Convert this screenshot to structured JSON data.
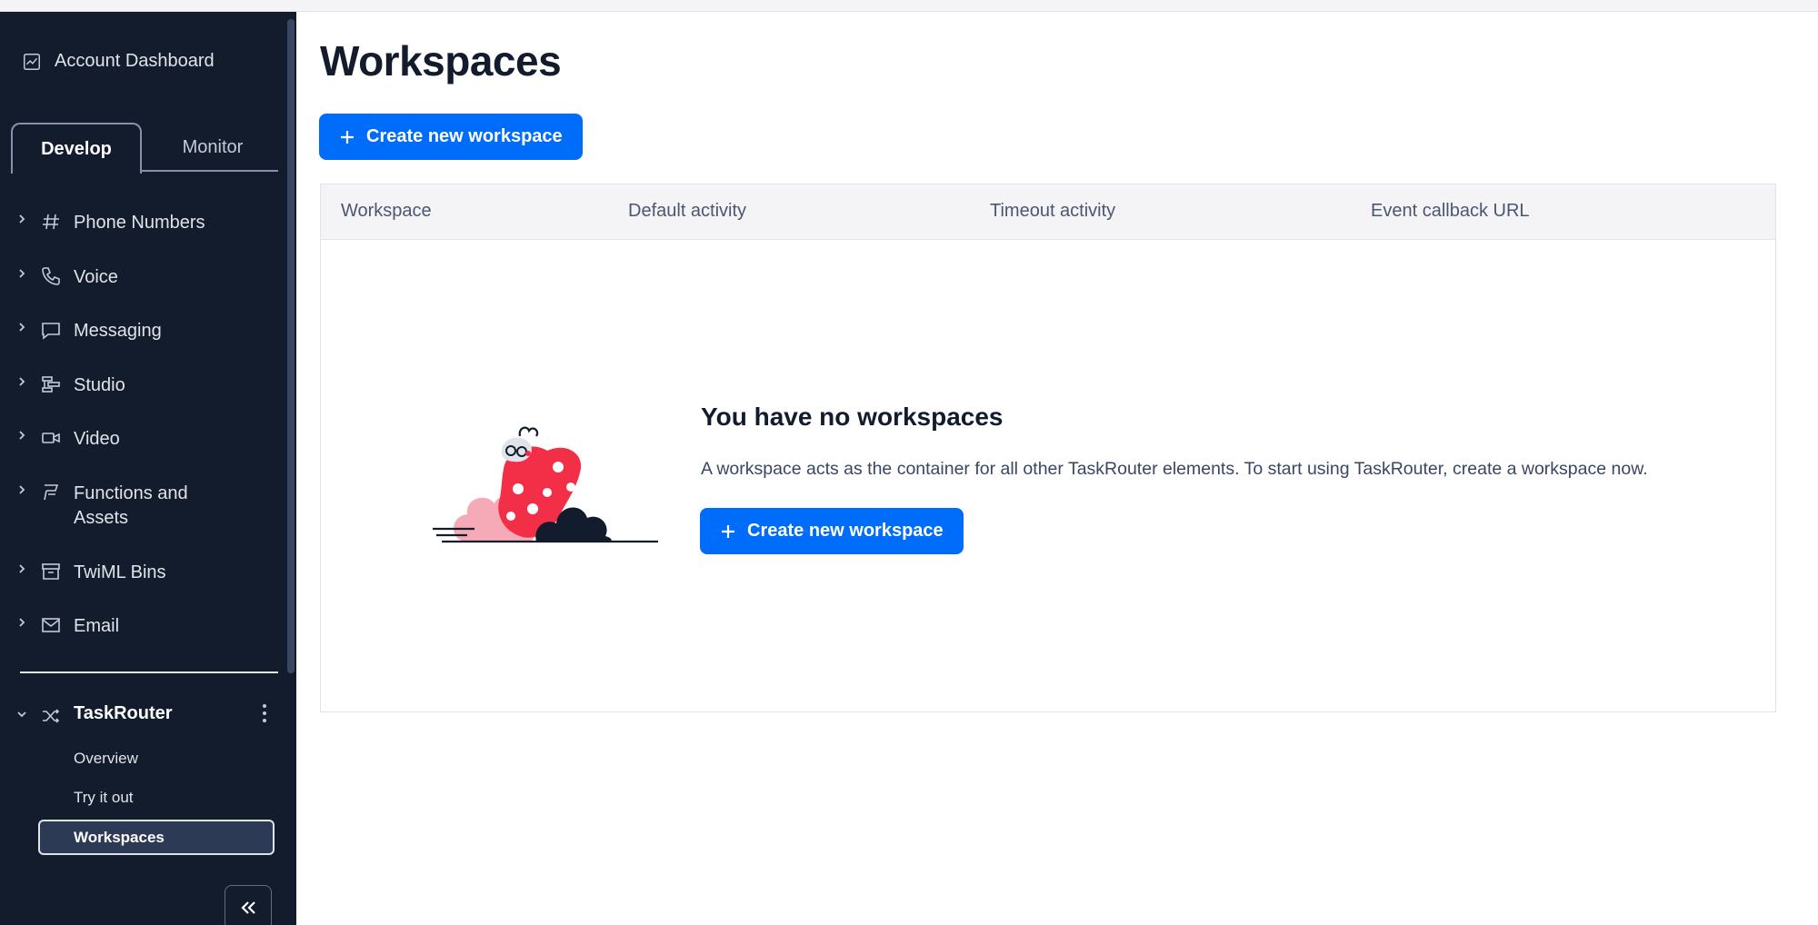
{
  "sidebar": {
    "account_dashboard": "Account Dashboard",
    "tabs": [
      {
        "label": "Develop",
        "active": true
      },
      {
        "label": "Monitor",
        "active": false
      }
    ],
    "items": [
      {
        "label": "Phone Numbers",
        "icon": "hash-icon"
      },
      {
        "label": "Voice",
        "icon": "phone-icon"
      },
      {
        "label": "Messaging",
        "icon": "chat-icon"
      },
      {
        "label": "Studio",
        "icon": "studio-icon"
      },
      {
        "label": "Video",
        "icon": "video-icon"
      },
      {
        "label": "Functions and Assets",
        "icon": "functions-icon"
      },
      {
        "label": "TwiML Bins",
        "icon": "bin-icon"
      },
      {
        "label": "Email",
        "icon": "email-icon"
      }
    ],
    "taskrouter": {
      "label": "TaskRouter",
      "subitems": [
        "Overview",
        "Try it out",
        "Workspaces"
      ],
      "active_subitem": "Workspaces"
    }
  },
  "main": {
    "title": "Workspaces",
    "create_button": "Create new workspace",
    "table": {
      "columns": [
        "Workspace",
        "Default activity",
        "Timeout activity",
        "Event callback URL"
      ]
    },
    "empty_state": {
      "title": "You have no workspaces",
      "description": "A workspace acts as the container for all other TaskRouter elements. To start using TaskRouter, create a workspace now.",
      "button": "Create new workspace"
    }
  },
  "colors": {
    "sidebar_bg": "#121c2d",
    "primary": "#006dfa",
    "text_dark": "#121c2d"
  }
}
